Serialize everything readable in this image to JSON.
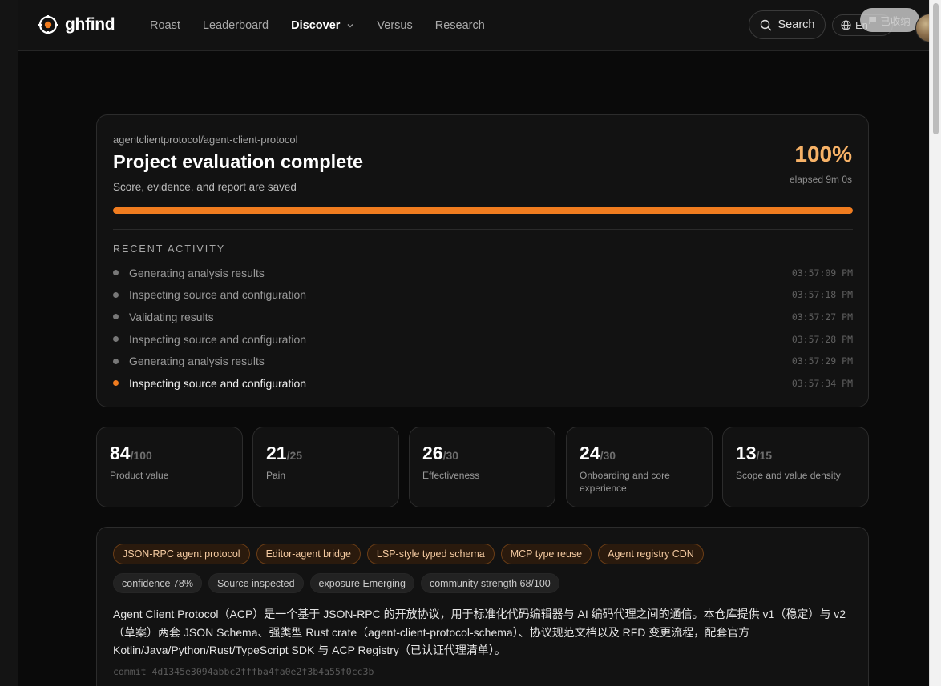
{
  "nav": {
    "brand": "ghfind",
    "links": [
      "Roast",
      "Leaderboard",
      "Discover",
      "Versus",
      "Research"
    ],
    "search_label": "Search",
    "lang_label": "En",
    "collapsed_label": "已收纳"
  },
  "progress": {
    "repo": "agentclientprotocol/agent-client-protocol",
    "title": "Project evaluation complete",
    "subtitle": "Score, evidence, and report are saved",
    "percent_label": "100%",
    "percent_value": 100,
    "elapsed": "elapsed 9m 0s",
    "activity_heading": "RECENT ACTIVITY",
    "activity": [
      {
        "text": "Generating analysis results",
        "time": "03:57:09 PM"
      },
      {
        "text": "Inspecting source and configuration",
        "time": "03:57:18 PM"
      },
      {
        "text": "Validating results",
        "time": "03:57:27 PM"
      },
      {
        "text": "Inspecting source and configuration",
        "time": "03:57:28 PM"
      },
      {
        "text": "Generating analysis results",
        "time": "03:57:29 PM"
      },
      {
        "text": "Inspecting source and configuration",
        "time": "03:57:34 PM"
      }
    ]
  },
  "scores": [
    {
      "value": "84",
      "max": "/100",
      "label": "Product value"
    },
    {
      "value": "21",
      "max": "/25",
      "label": "Pain"
    },
    {
      "value": "26",
      "max": "/30",
      "label": "Effectiveness"
    },
    {
      "value": "24",
      "max": "/30",
      "label": "Onboarding and core experience"
    },
    {
      "value": "13",
      "max": "/15",
      "label": "Scope and value density"
    }
  ],
  "tags": {
    "topics": [
      "JSON-RPC agent protocol",
      "Editor-agent bridge",
      "LSP-style typed schema",
      "MCP type reuse",
      "Agent registry CDN"
    ],
    "meta": [
      "confidence 78%",
      "Source inspected",
      "exposure Emerging",
      "community strength 68/100"
    ]
  },
  "summary": "Agent Client Protocol（ACP）是一个基于 JSON-RPC 的开放协议，用于标准化代码编辑器与 AI 编码代理之间的通信。本仓库提供 v1（稳定）与 v2（草案）两套 JSON Schema、强类型 Rust crate（agent-client-protocol-schema）、协议规范文档以及 RFD 变更流程，配套官方 Kotlin/Java/Python/Rust/TypeScript SDK 与 ACP Registry（已认证代理清单）。",
  "commit": "commit 4d1345e3094abbc2fffba4fa0e2f3b4a55f0cc3b",
  "colors": {
    "accent": "#f07c1f",
    "percent": "#f7b267",
    "background": "#0a0a0a"
  }
}
